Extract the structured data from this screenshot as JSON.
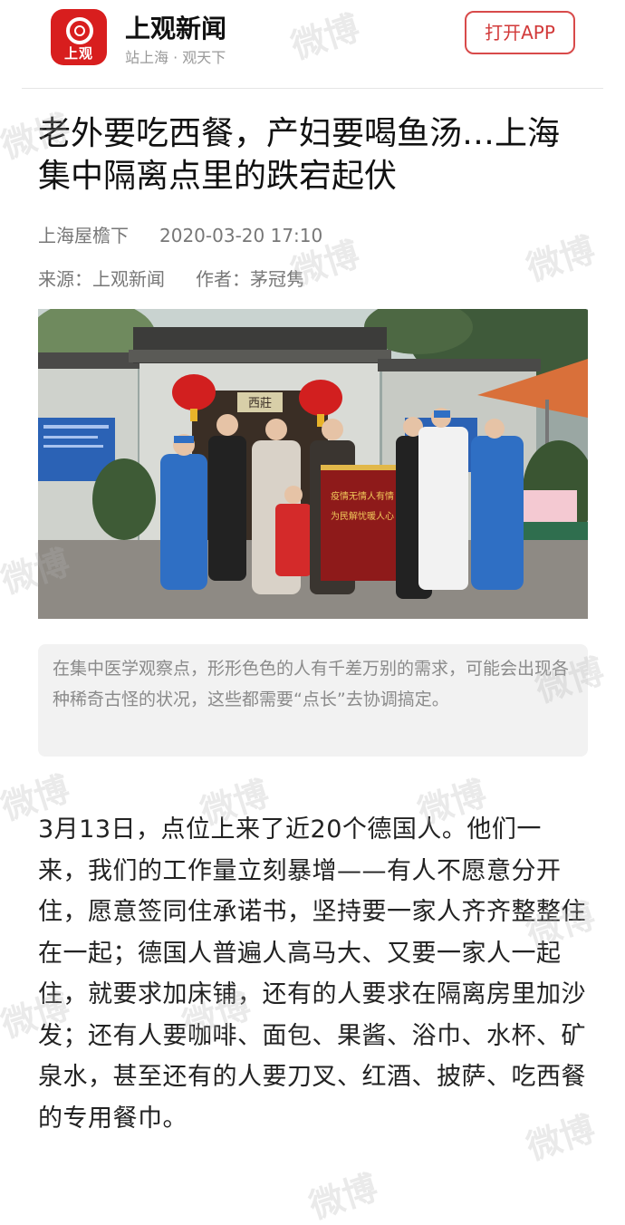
{
  "header": {
    "logo_text": "上观",
    "brand_name": "上观新闻",
    "slogan": "站上海 · 观天下",
    "open_app_label": "打开APP"
  },
  "article": {
    "title": "老外要吃西餐，产妇要喝鱼汤…上海集中隔离点里的跌宕起伏",
    "column": "上海屋檐下",
    "date": "2020-03-20 17:10",
    "source_label": "来源：上观新闻",
    "author_label": "作者：茅冠隽",
    "photo_alt": "people in protective suits holding a red banner in front of a gate",
    "banner_text": "疫情无情人有情 为民解忧暖人心",
    "gate_plaque": "西莊",
    "caption": "在集中医学观察点，形形色色的人有千差万别的需求，可能会出现各种稀奇古怪的状况，这些都需要“点长”去协调搞定。",
    "body": "3月13日，点位上来了近20个德国人。他们一来，我们的工作量立刻暴增——有人不愿意分开住，愿意签同住承诺书，坚持要一家人齐齐整整住在一起；德国人普遍人高马大、又要一家人一起住，就要求加床铺，还有的人要求在隔离房里加沙发；还有人要咖啡、面包、果酱、浴巾、水杯、矿泉水，甚至还有的人要刀叉、红酒、披萨、吃西餐的专用餐巾。"
  },
  "watermark_text": "微博",
  "colors": {
    "brand_red": "#d81e1e",
    "button_red": "#d23a3a",
    "caption_bg": "#f2f2f2"
  }
}
